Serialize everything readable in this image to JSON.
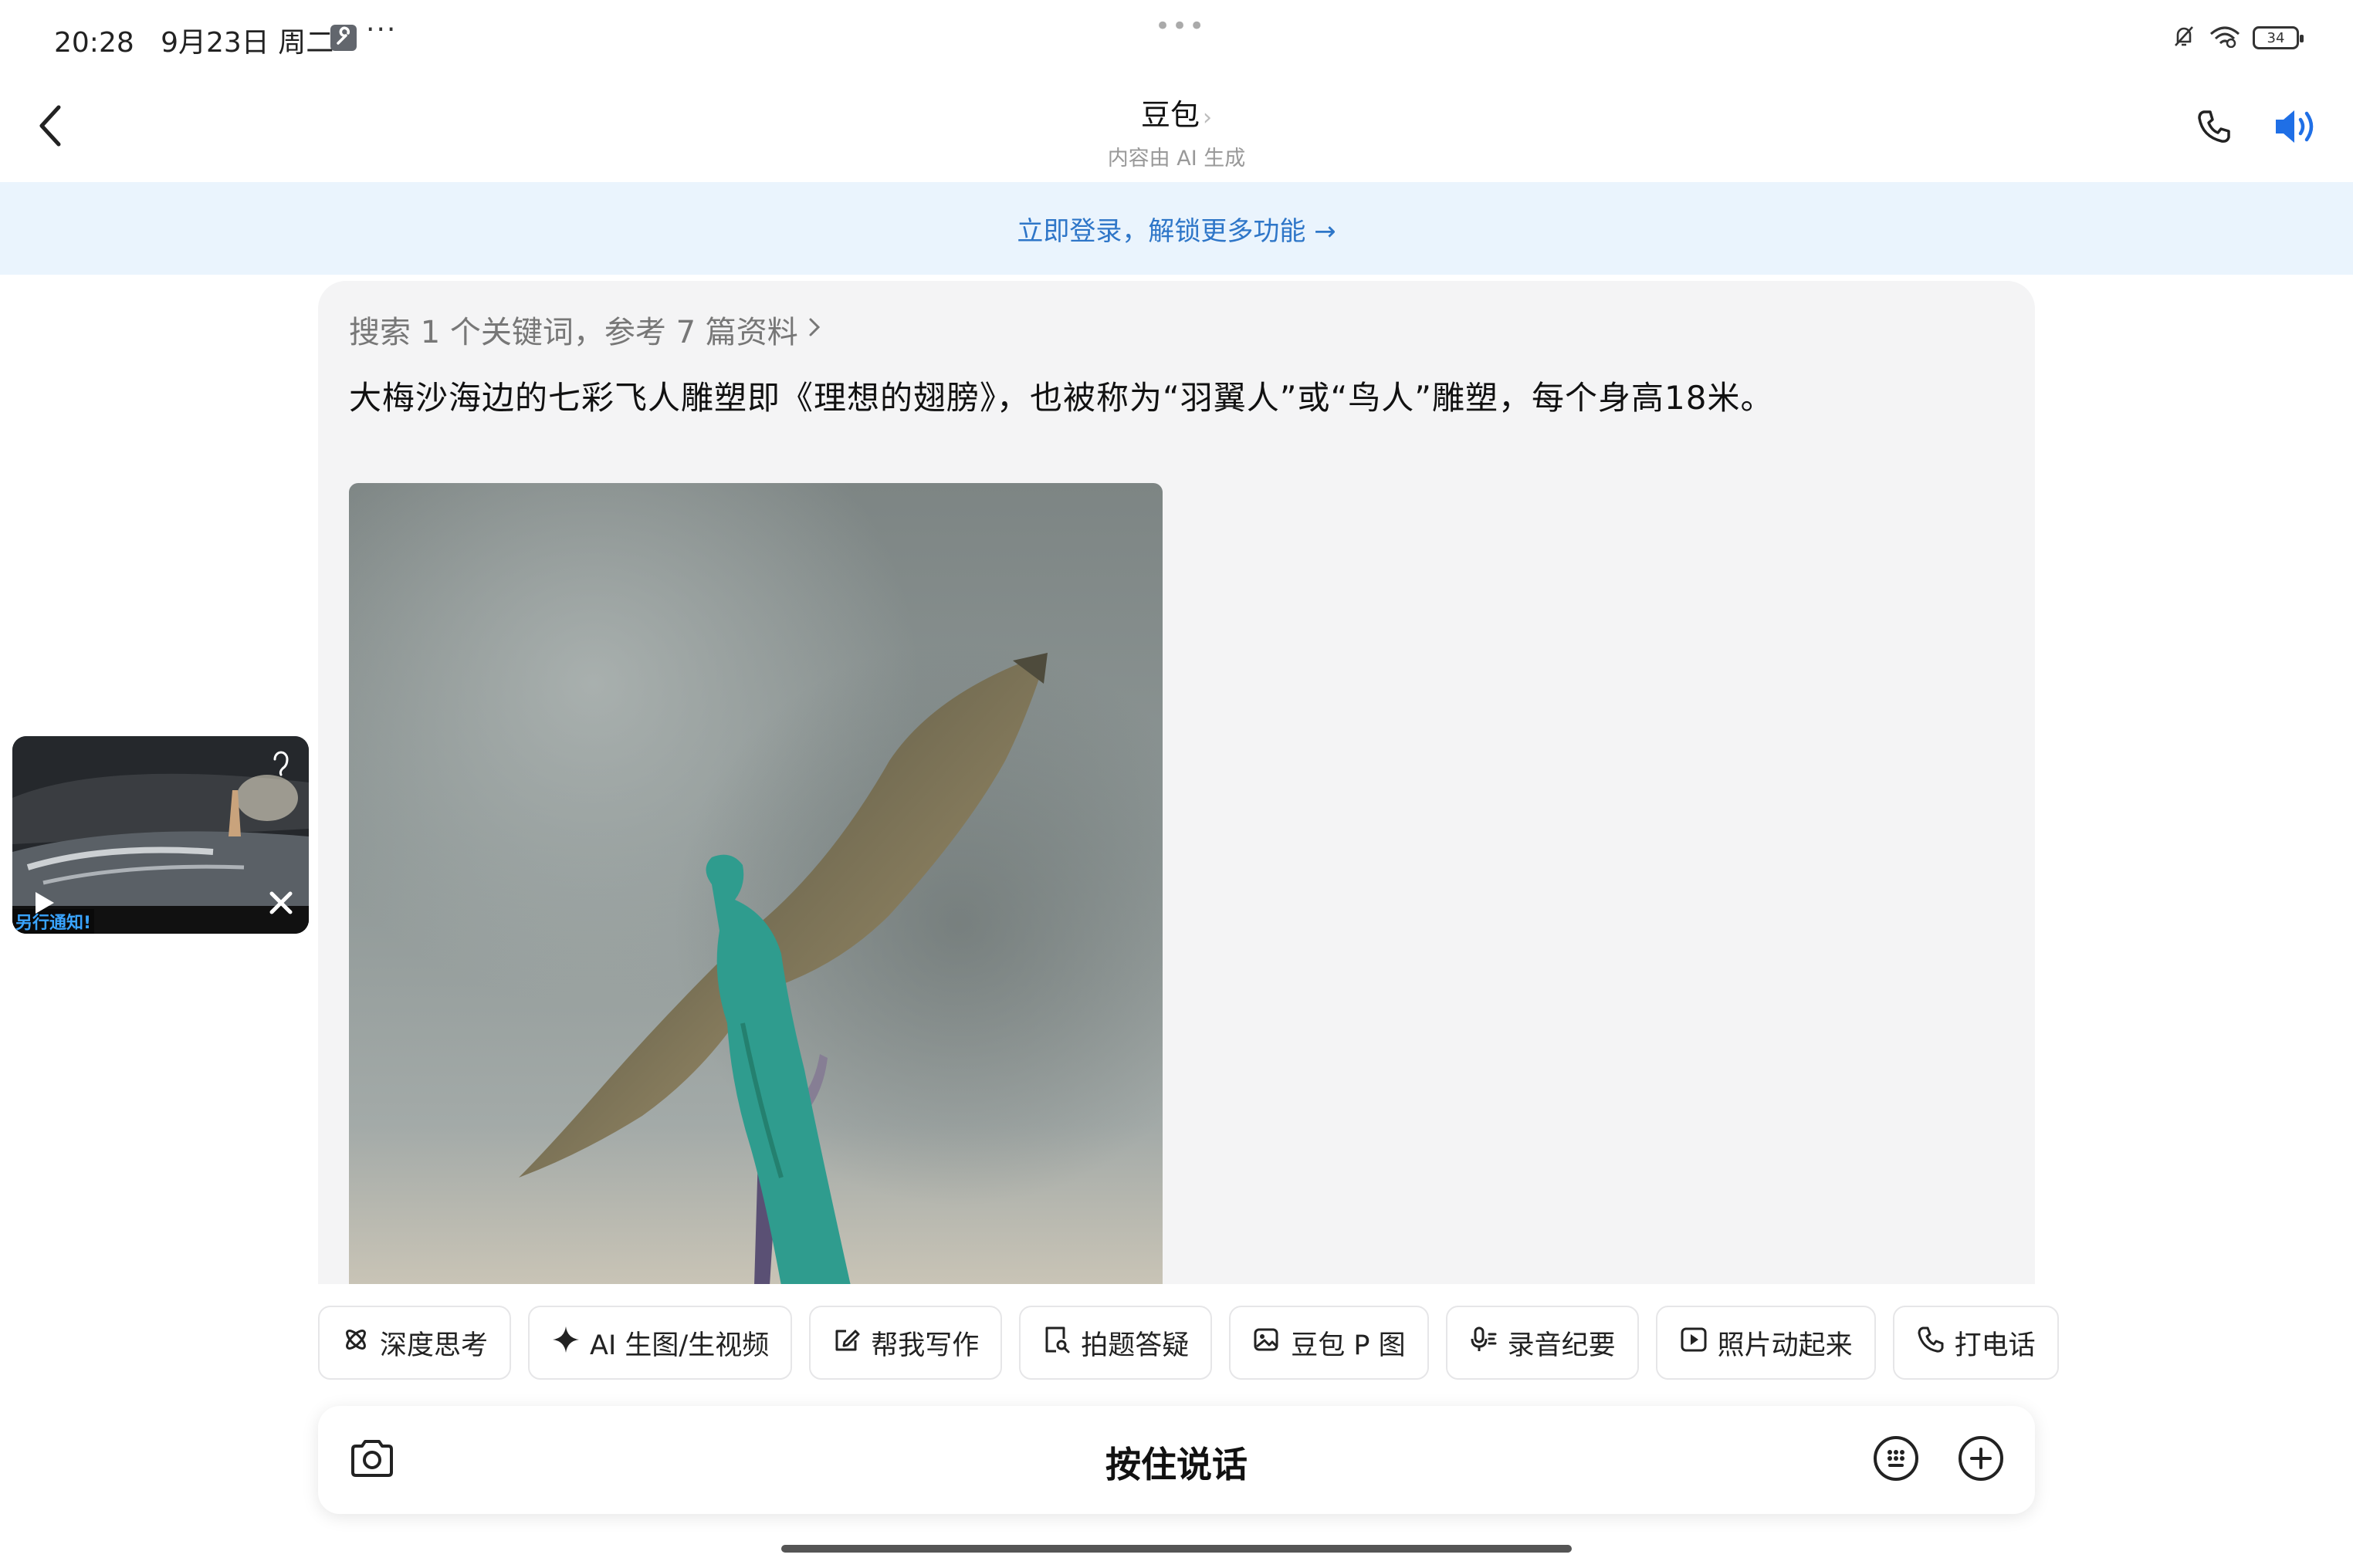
{
  "status_bar": {
    "time": "20:28",
    "date": "9月23日 周二",
    "more": "···",
    "center_dots": "•••",
    "battery": "34",
    "icons": [
      "bell-muted-icon",
      "wifi-icon",
      "battery-icon"
    ]
  },
  "header": {
    "title": "豆包",
    "title_chevron": "›",
    "subtitle": "内容由 AI 生成",
    "icons": [
      "back-icon",
      "phone-icon",
      "speaker-icon"
    ]
  },
  "login_banner": {
    "text": "立即登录，解锁更多功能 →"
  },
  "message": {
    "search_ref": "搜索 1 个关键词，参考 7 篇资料",
    "search_ref_chevron": "›",
    "answer": "大梅沙海边的七彩飞人雕塑即《理想的翅膀》，也被称为“羽翼人”或“鸟人”雕塑，每个身高18米。"
  },
  "float_video": {
    "caption": "另行通知!"
  },
  "chips": [
    {
      "label": "深度思考",
      "icon": "atom-icon"
    },
    {
      "label": "AI 生图/生视频",
      "icon": "sparkle-icon"
    },
    {
      "label": "帮我写作",
      "icon": "edit-icon"
    },
    {
      "label": "拍题答疑",
      "icon": "doc-search-icon"
    },
    {
      "label": "豆包 P 图",
      "icon": "image-edit-icon"
    },
    {
      "label": "录音纪要",
      "icon": "mic-icon"
    },
    {
      "label": "照片动起来",
      "icon": "play-square-icon"
    },
    {
      "label": "打电话",
      "icon": "phone-icon"
    }
  ],
  "input_bar": {
    "hold_to_talk": "按住说话",
    "icons": [
      "camera-icon",
      "emoji-icon",
      "plus-icon"
    ]
  },
  "colors": {
    "accent_blue": "#1f6fe6",
    "banner_bg": "#eaf4fd",
    "banner_text": "#2e76c8",
    "card_bg": "#f4f4f5"
  }
}
